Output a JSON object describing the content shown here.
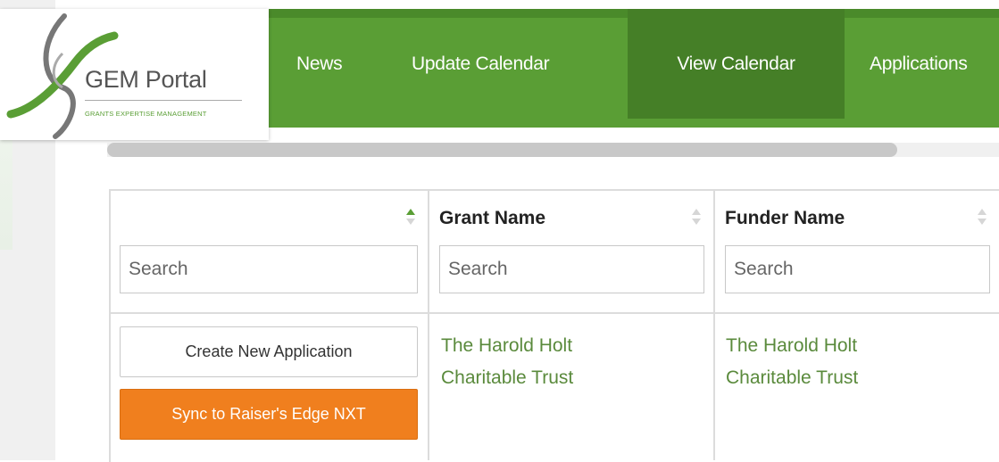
{
  "logo": {
    "title": "GEM Portal",
    "subtitle": "GRANTS EXPERTISE MANAGEMENT"
  },
  "nav": {
    "items": [
      {
        "label": "News",
        "active": false
      },
      {
        "label": "Update Calendar",
        "active": false
      },
      {
        "label": "View Calendar",
        "active": true
      },
      {
        "label": "Applications",
        "active": false
      }
    ]
  },
  "colors": {
    "brand_green": "#5a9e35",
    "active_green": "#457f27",
    "sync_orange": "#f07f1e",
    "link_green": "#5a8a3c"
  },
  "table": {
    "columns": [
      {
        "title": "",
        "sort": "ascending",
        "search_placeholder": "Search"
      },
      {
        "title": "Grant Name",
        "sort": "none",
        "search_placeholder": "Search"
      },
      {
        "title": "Funder Name",
        "sort": "none",
        "search_placeholder": "Search"
      }
    ],
    "rows": [
      {
        "actions": {
          "create_label": "Create New Application",
          "sync_label": "Sync to Raiser's Edge NXT"
        },
        "grant_name": "The Harold Holt Charitable Trust",
        "funder_name": "The Harold Holt Charitable Trust"
      }
    ]
  }
}
